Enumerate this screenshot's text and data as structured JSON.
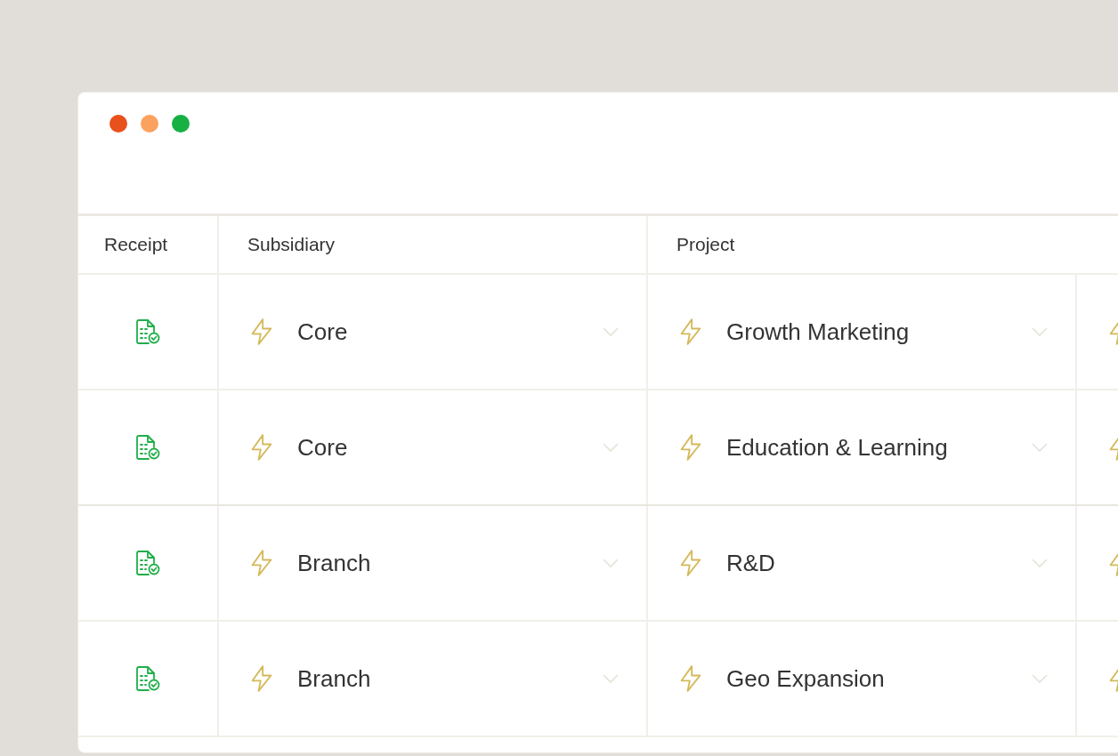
{
  "table": {
    "columns": [
      "Receipt",
      "Subsidiary",
      "Project"
    ],
    "rows": [
      {
        "subsidiary": "Core",
        "project": "Growth Marketing"
      },
      {
        "subsidiary": "Core",
        "project": "Education & Learning"
      },
      {
        "subsidiary": "Branch",
        "project": "R&D"
      },
      {
        "subsidiary": "Branch",
        "project": "Geo Expansion"
      }
    ]
  }
}
